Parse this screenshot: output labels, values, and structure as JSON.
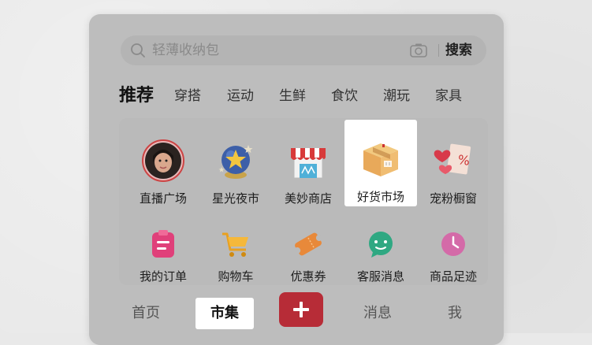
{
  "search": {
    "placeholder": "轻薄收纳包",
    "button_label": "搜索"
  },
  "tabs": [
    {
      "label": "推荐",
      "active": true
    },
    {
      "label": "穿搭"
    },
    {
      "label": "运动"
    },
    {
      "label": "生鲜"
    },
    {
      "label": "食饮"
    },
    {
      "label": "潮玩"
    },
    {
      "label": "家具"
    }
  ],
  "grid": {
    "row1": [
      {
        "label": "直播广场",
        "icon": "live-avatar-icon"
      },
      {
        "label": "星光夜市",
        "icon": "star-globe-icon"
      },
      {
        "label": "美妙商店",
        "icon": "shop-icon"
      },
      {
        "label": "好货市场",
        "icon": "parcel-box-icon",
        "highlighted": true
      },
      {
        "label": "宠粉橱窗",
        "icon": "hearts-percent-icon"
      }
    ],
    "row2": [
      {
        "label": "我的订单",
        "icon": "order-clipboard-icon"
      },
      {
        "label": "购物车",
        "icon": "shopping-cart-icon"
      },
      {
        "label": "优惠券",
        "icon": "coupon-icon"
      },
      {
        "label": "客服消息",
        "icon": "chat-bubble-icon"
      },
      {
        "label": "商品足迹",
        "icon": "clock-icon"
      }
    ]
  },
  "bottom_nav": [
    {
      "label": "首页"
    },
    {
      "label": "市集",
      "highlighted": true
    },
    {
      "label": "",
      "icon": "plus-icon"
    },
    {
      "label": "消息"
    },
    {
      "label": "我"
    }
  ],
  "colors": {
    "accent": "#b72c37",
    "panel": "#bdbdbd",
    "highlight": "#ffffff"
  }
}
